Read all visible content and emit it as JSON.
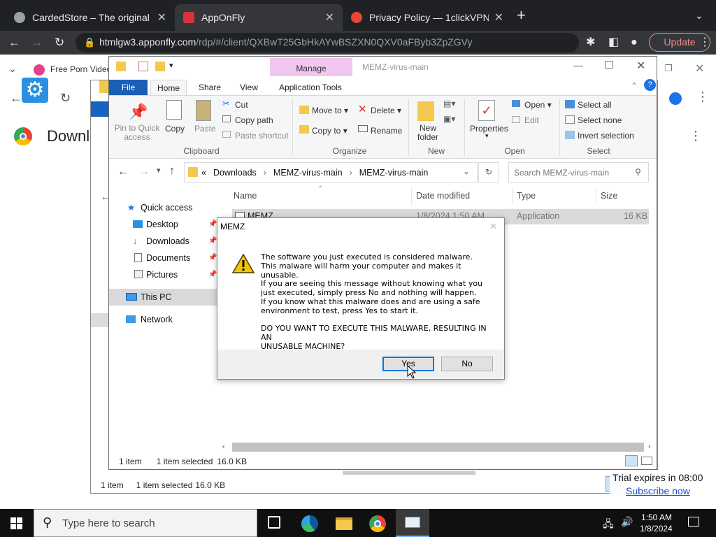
{
  "browser": {
    "tabs": [
      {
        "title": "CardedStore – The original car",
        "favicon_color": "#9aa0a6"
      },
      {
        "title": "AppOnFly",
        "favicon_color": "#d8323c"
      },
      {
        "title": "Privacy Policy — 1clickVPN",
        "favicon_color": "#ea4335"
      }
    ],
    "new_tab": "+",
    "url_host": "htmlgw3.apponfly.com",
    "url_path": "/rdp/#/client/QXBwT25GbHkAYwBSZXN0QXV0aFByb3ZpZGVy",
    "update_label": "Update"
  },
  "remote_page": {
    "bookmark": "Free Porn Video",
    "heading": "Downl"
  },
  "explorer": {
    "window_title": "MEMZ-virus-main",
    "manage_label": "Manage",
    "ribbon_tabs": [
      "File",
      "Home",
      "Share",
      "View",
      "Application Tools"
    ],
    "clipboard": {
      "pin": "Pin to Quick access",
      "copy": "Copy",
      "paste": "Paste",
      "cut": "Cut",
      "copy_path": "Copy path",
      "paste_shortcut": "Paste shortcut",
      "label": "Clipboard"
    },
    "organize": {
      "move_to": "Move to",
      "copy_to": "Copy to",
      "delete": "Delete",
      "rename": "Rename",
      "label": "Organize"
    },
    "new_group": {
      "new_folder": "New folder",
      "label": "New"
    },
    "open_group": {
      "properties": "Properties",
      "open": "Open",
      "edit": "Edit",
      "label": "Open"
    },
    "select_group": {
      "select_all": "Select all",
      "select_none": "Select none",
      "invert": "Invert selection",
      "label": "Select"
    },
    "breadcrumb": [
      "«",
      "Downloads",
      "MEMZ-virus-main",
      "MEMZ-virus-main"
    ],
    "search_placeholder": "Search MEMZ-virus-main",
    "columns": [
      "Name",
      "Date modified",
      "Type",
      "Size"
    ],
    "row": {
      "name": "MEMZ",
      "date": "1/8/2024 1:50 AM",
      "type": "Application",
      "size": "16 KB"
    },
    "nav": {
      "quick_access": "Quick access",
      "desktop": "Desktop",
      "downloads": "Downloads",
      "documents": "Documents",
      "pictures": "Pictures",
      "this_pc": "This PC",
      "network": "Network"
    },
    "status": {
      "count": "1 item",
      "selected": "1 item selected",
      "size": "16.0 KB"
    }
  },
  "back_window_status": {
    "count": "1 item",
    "selected": "1 item selected",
    "size": "16.0 KB"
  },
  "dialog": {
    "title": "MEMZ",
    "message": "The software you just executed is considered malware.\nThis malware will harm your computer and makes it unusable.\nIf you are seeing this message without knowing what you\njust executed, simply press No and nothing will happen.\nIf you know what this malware does and are using a safe\nenvironment to test, press Yes to start it.\n\nDO YOU WANT TO EXECUTE THIS MALWARE, RESULTING IN AN\nUNUSABLE MACHINE?",
    "yes": "Yes",
    "no": "No"
  },
  "trial": {
    "text": "Trial expires in 08:00",
    "link": "Subscribe now"
  },
  "taskbar": {
    "search_placeholder": "Type here to search",
    "time": "1:50 AM",
    "date": "1/8/2024"
  }
}
